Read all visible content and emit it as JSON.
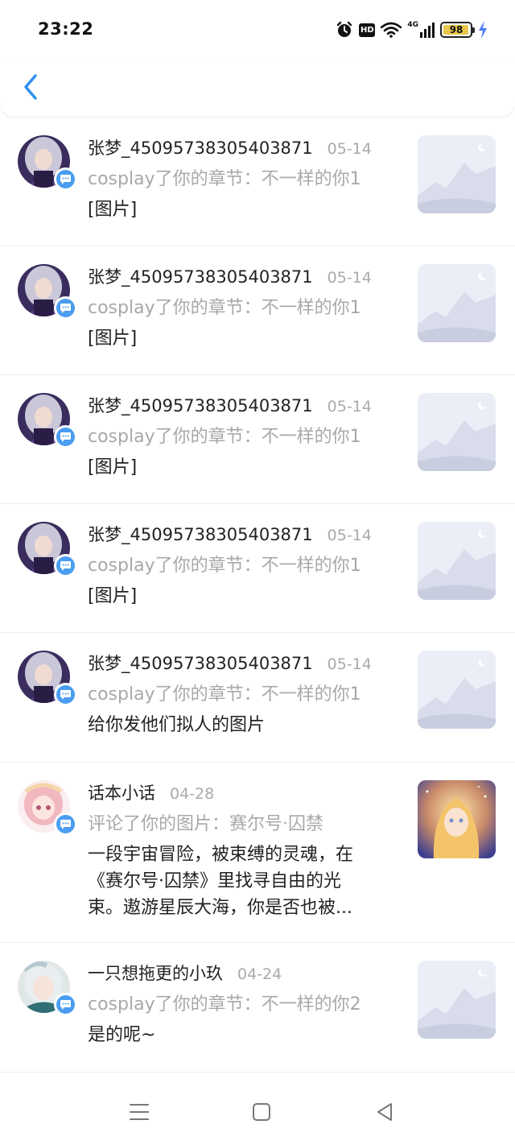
{
  "status_bar": {
    "time": "23:22",
    "hd_label": "HD",
    "network_label": "4G",
    "battery_level": 98,
    "battery_text": "98",
    "battery_fill_color": "#e8c84b",
    "charging_color": "#4a7bf5"
  },
  "nav": {
    "back_icon": "chevron-left-icon",
    "accent_color": "#2f8ff0"
  },
  "badge_color": "#4a9df0",
  "notifications": [
    {
      "user": "张梦_45095738305403871",
      "date": "05-14",
      "summary": "cosplay了你的章节：不一样的你1",
      "message": "[图片]",
      "avatar": "girl-silver-hair",
      "thumb": "placeholder-mountain"
    },
    {
      "user": "张梦_45095738305403871",
      "date": "05-14",
      "summary": "cosplay了你的章节：不一样的你1",
      "message": "[图片]",
      "avatar": "girl-silver-hair",
      "thumb": "placeholder-mountain"
    },
    {
      "user": "张梦_45095738305403871",
      "date": "05-14",
      "summary": "cosplay了你的章节：不一样的你1",
      "message": "[图片]",
      "avatar": "girl-silver-hair",
      "thumb": "placeholder-mountain"
    },
    {
      "user": "张梦_45095738305403871",
      "date": "05-14",
      "summary": "cosplay了你的章节：不一样的你1",
      "message": "[图片]",
      "avatar": "girl-silver-hair",
      "thumb": "placeholder-mountain"
    },
    {
      "user": "张梦_45095738305403871",
      "date": "05-14",
      "summary": "cosplay了你的章节：不一样的你1",
      "message": "给你发他们拟人的图片",
      "avatar": "girl-silver-hair",
      "thumb": "placeholder-mountain"
    },
    {
      "user": "话本小话",
      "date": "04-28",
      "summary": "评论了你的图片：赛尔号·囚禁",
      "message": "一段宇宙冒险，被束缚的灵魂，在\n《赛尔号·囚禁》里找寻自由的光\n束。遨游星辰大海，你是否也被...",
      "avatar": "girl-pink-hair",
      "thumb": "anime-golden-hair"
    },
    {
      "user": "一只想拖更的小玖",
      "date": "04-24",
      "summary": "cosplay了你的章节：不一样的你2",
      "message": "是的呢~",
      "avatar": "boy-teal-hair",
      "thumb": "placeholder-mountain"
    }
  ],
  "system_nav": {
    "menu_icon": "menu-icon",
    "home_icon": "home-square-icon",
    "back_icon": "back-triangle-icon"
  }
}
